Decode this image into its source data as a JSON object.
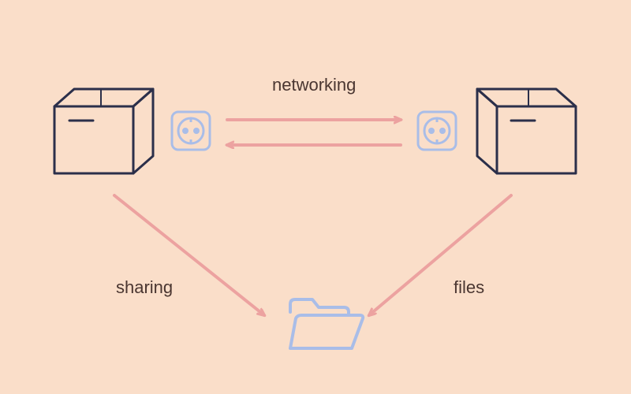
{
  "diagram": {
    "labels": {
      "networking": "networking",
      "sharing": "sharing",
      "files": "files"
    },
    "colors": {
      "background": "#fadec9",
      "box_outline": "#2b2f4a",
      "arrow": "#eca2a0",
      "socket_outline": "#a9bde8",
      "folder_outline": "#a9bde8",
      "text": "#4a3631"
    },
    "nodes": [
      {
        "id": "box-left",
        "type": "box"
      },
      {
        "id": "socket-left",
        "type": "socket"
      },
      {
        "id": "socket-right",
        "type": "socket"
      },
      {
        "id": "box-right",
        "type": "box"
      },
      {
        "id": "folder",
        "type": "folder"
      }
    ],
    "edges": [
      {
        "from": "socket-left",
        "to": "socket-right",
        "label": "networking",
        "bidirectional": true
      },
      {
        "from": "box-left",
        "to": "folder",
        "label": "sharing"
      },
      {
        "from": "box-right",
        "to": "folder",
        "label": "files"
      }
    ]
  }
}
